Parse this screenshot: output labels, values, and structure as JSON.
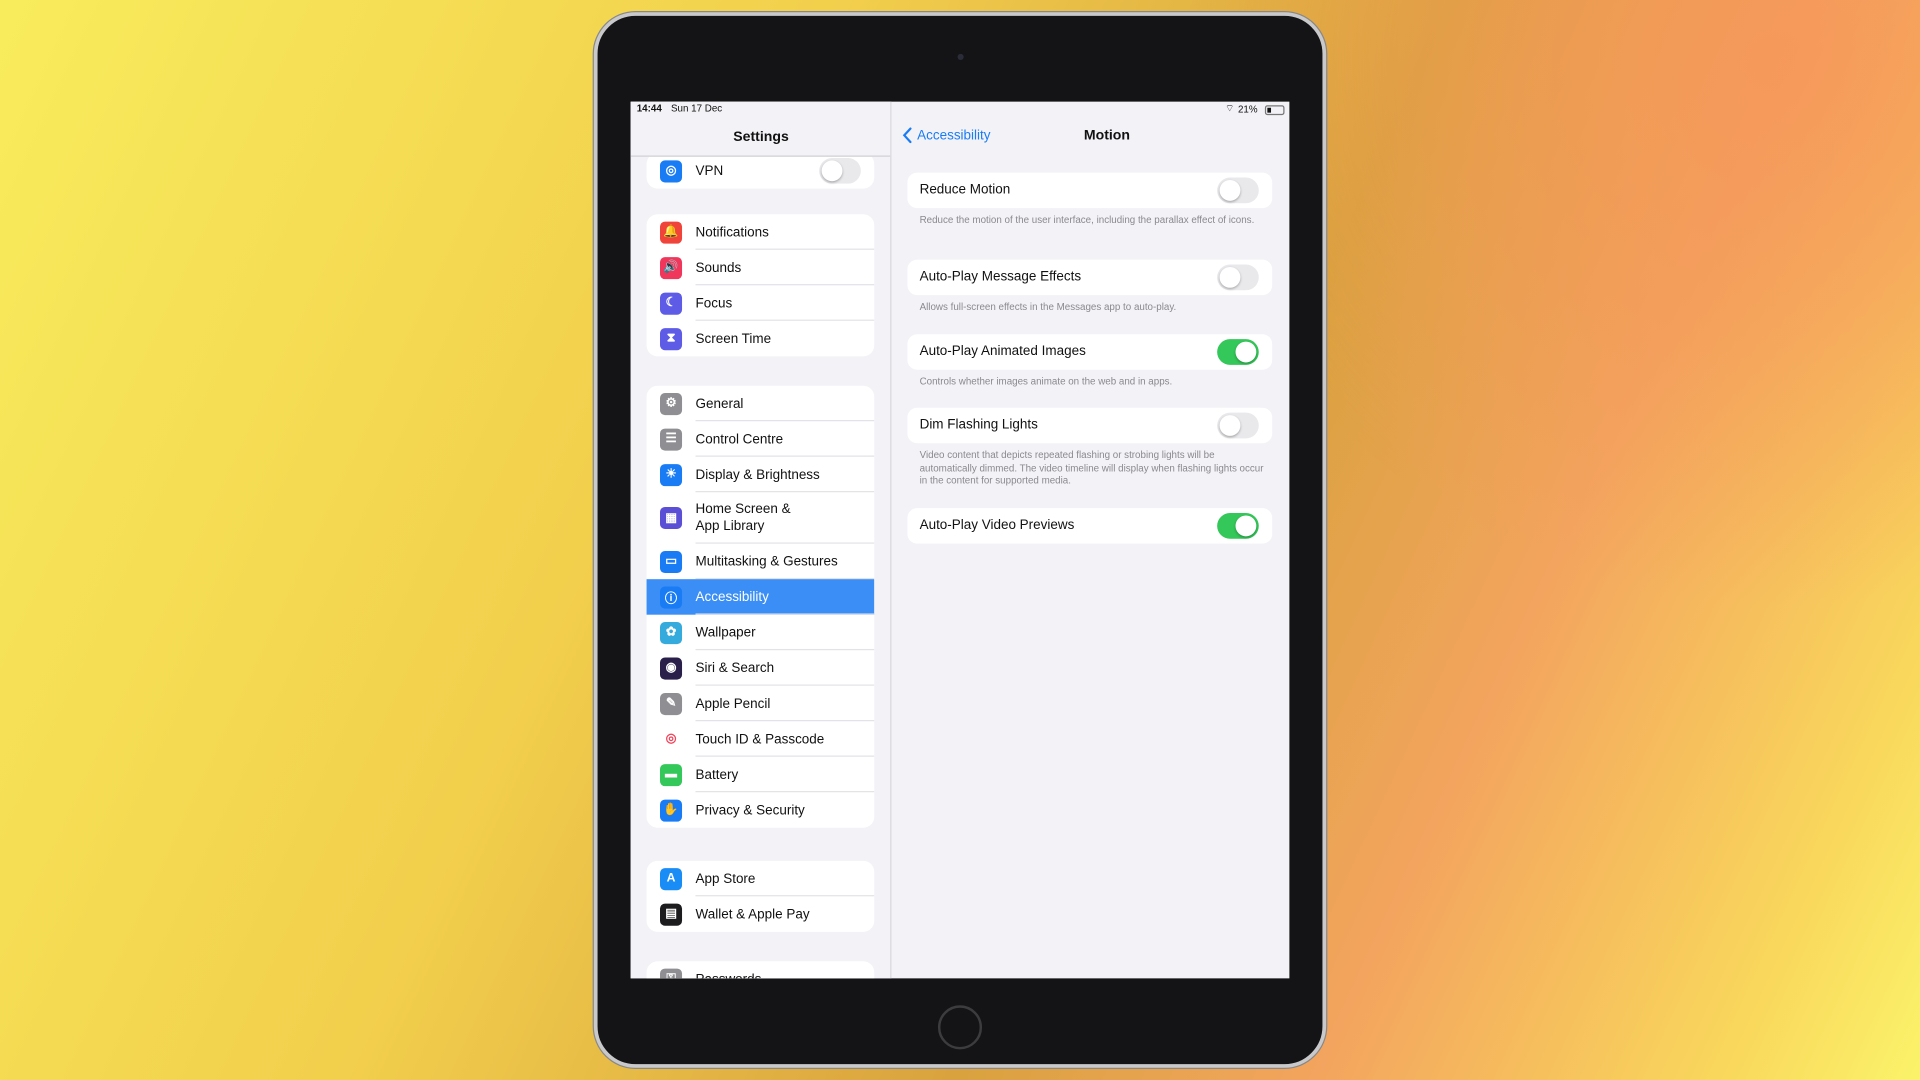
{
  "status_bar": {
    "time": "14:44",
    "date": "Sun 17 Dec",
    "battery": "21%"
  },
  "sidebar": {
    "title": "Settings",
    "groups": [
      [
        {
          "label": "VPN",
          "icon": "vpn-icon",
          "color": "#1a7cf5",
          "glyph": "◎",
          "toggle": false
        }
      ],
      [
        {
          "label": "Notifications",
          "icon": "notifications-icon",
          "color": "#f0443a",
          "glyph": "🔔"
        },
        {
          "label": "Sounds",
          "icon": "sounds-icon",
          "color": "#f0365a",
          "glyph": "🔊"
        },
        {
          "label": "Focus",
          "icon": "focus-icon",
          "color": "#5e5ce6",
          "glyph": "☾"
        },
        {
          "label": "Screen Time",
          "icon": "screen-time-icon",
          "color": "#5e5ce6",
          "glyph": "⧗"
        }
      ],
      [
        {
          "label": "General",
          "icon": "gear-icon",
          "color": "#8e8e93",
          "glyph": "⚙"
        },
        {
          "label": "Control Centre",
          "icon": "control-centre-icon",
          "color": "#8e8e93",
          "glyph": "☰"
        },
        {
          "label": "Display & Brightness",
          "icon": "brightness-icon",
          "color": "#1a7cf5",
          "glyph": "☀"
        },
        {
          "label": "Home Screen &\nApp Library",
          "icon": "home-screen-icon",
          "color": "#5b4fd6",
          "glyph": "▦"
        },
        {
          "label": "Multitasking & Gestures",
          "icon": "multitasking-icon",
          "color": "#1a7cf5",
          "glyph": "▭"
        },
        {
          "label": "Accessibility",
          "icon": "accessibility-icon",
          "color": "#1a7cf5",
          "glyph": "ⓘ",
          "selected": true
        },
        {
          "label": "Wallpaper",
          "icon": "wallpaper-icon",
          "color": "#35aadc",
          "glyph": "✿"
        },
        {
          "label": "Siri & Search",
          "icon": "siri-icon",
          "color": "#2a1f4a",
          "glyph": "◉"
        },
        {
          "label": "Apple Pencil",
          "icon": "pencil-icon",
          "color": "#8e8e93",
          "glyph": "✎"
        },
        {
          "label": "Touch ID & Passcode",
          "icon": "fingerprint-icon",
          "color": "#ffffff",
          "glyph": "◎",
          "glyph_color": "#f0445a"
        },
        {
          "label": "Battery",
          "icon": "battery-icon",
          "color": "#34c759",
          "glyph": "▬"
        },
        {
          "label": "Privacy & Security",
          "icon": "hand-icon",
          "color": "#1a7cf5",
          "glyph": "✋"
        }
      ],
      [
        {
          "label": "App Store",
          "icon": "app-store-icon",
          "color": "#1a8cf5",
          "glyph": "A"
        },
        {
          "label": "Wallet & Apple Pay",
          "icon": "wallet-icon",
          "color": "#1c1c1e",
          "glyph": "▤"
        }
      ],
      [
        {
          "label": "Passwords",
          "icon": "key-icon",
          "color": "#8e8e93",
          "glyph": "⚿"
        }
      ]
    ]
  },
  "detail": {
    "back_label": "Accessibility",
    "title": "Motion",
    "settings": [
      {
        "label": "Reduce Motion",
        "on": false,
        "footer": "Reduce the motion of the user interface, including the parallax effect of icons."
      },
      {
        "label": "Auto-Play Message Effects",
        "on": false,
        "footer": "Allows full-screen effects in the Messages app to auto-play."
      },
      {
        "label": "Auto-Play Animated Images",
        "on": true,
        "footer": "Controls whether images animate on the web and in apps."
      },
      {
        "label": "Dim Flashing Lights",
        "on": false,
        "footer": "Video content that depicts repeated flashing or strobing lights will be automatically dimmed. The video timeline will display when flashing lights occur in the content for supported media."
      },
      {
        "label": "Auto-Play Video Previews",
        "on": true,
        "footer": ""
      }
    ]
  },
  "colors": {
    "accent": "#1a7cf5",
    "toggle_on": "#34c759",
    "selected_row": "#3a8ef6"
  }
}
